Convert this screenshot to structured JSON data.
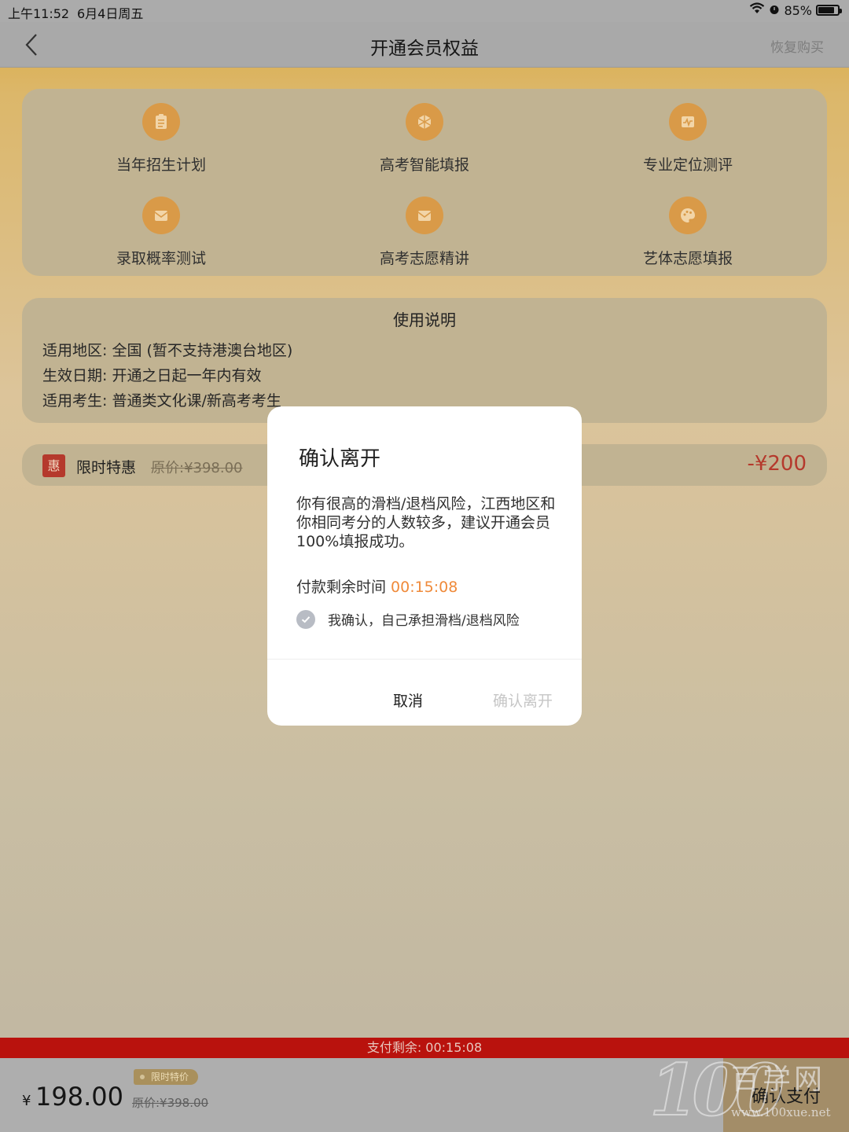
{
  "status_bar": {
    "time": "上午11:52",
    "date": "6月4日周五",
    "battery": "85%",
    "battery_level": 0.85
  },
  "nav": {
    "title": "开通会员权益",
    "restore": "恢复购买"
  },
  "features": [
    {
      "label": "当年招生计划",
      "icon": "clipboard-icon"
    },
    {
      "label": "高考智能填报",
      "icon": "cube-icon"
    },
    {
      "label": "专业定位测评",
      "icon": "chart-icon"
    },
    {
      "label": "录取概率测试",
      "icon": "envelope-icon"
    },
    {
      "label": "高考志愿精讲",
      "icon": "envelope-icon"
    },
    {
      "label": "艺体志愿填报",
      "icon": "palette-icon"
    }
  ],
  "usage": {
    "title": "使用说明",
    "lines": [
      "适用地区: 全国 (暂不支持港澳台地区)",
      "生效日期: 开通之日起一年内有效",
      "适用考生: 普通类文化课/新高考考生"
    ]
  },
  "promo": {
    "badge": "惠",
    "label": "限时特惠",
    "original_price": "原价:¥398.00",
    "discount": "-¥200"
  },
  "bottom": {
    "countdown": "支付剩余: 00:15:08",
    "currency": "¥",
    "price": "198.00",
    "price_tag": "限时特价",
    "original_price": "原价:¥398.00",
    "pay_button": "确认支付"
  },
  "watermark": {
    "number": "100",
    "name": "百学网",
    "url": "www.100xue.net"
  },
  "modal": {
    "title": "确认离开",
    "message": "你有很高的滑档/退档风险，江西地区和你相同考分的人数较多，建议开通会员100%填报成功。",
    "timer_label": "付款剩余时间",
    "timer_value": "00:15:08",
    "confirm_text": "我确认，自己承担滑档/退档风险",
    "cancel": "取消",
    "leave": "确认离开"
  },
  "colors": {
    "accent_red": "#b9120d",
    "discount_red": "#b5392c",
    "timer_orange": "#ef8a3a",
    "icon_orange": "#d99a48"
  }
}
